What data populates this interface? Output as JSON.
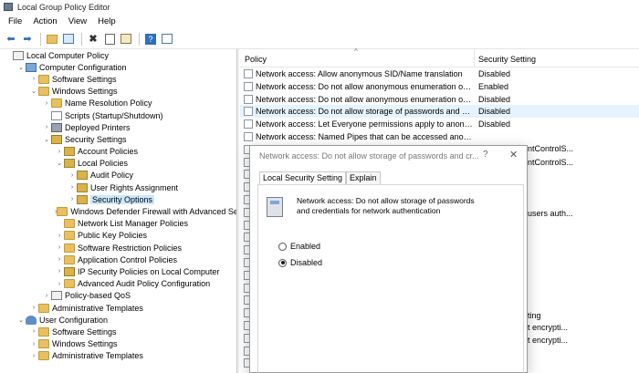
{
  "window": {
    "title": "Local Group Policy Editor"
  },
  "menu": {
    "items": [
      "File",
      "Action",
      "View",
      "Help"
    ]
  },
  "toolbar": {
    "icons": [
      "back-arrow-icon",
      "forward-arrow-icon",
      "up-folder-icon",
      "show-hide-tree-icon",
      "delete-icon",
      "properties-icon",
      "export-icon",
      "help-icon",
      "console-icon"
    ]
  },
  "tree": {
    "nodes": [
      {
        "label": "Local Computer Policy",
        "depth": 0,
        "icon": "policy",
        "twisty": ""
      },
      {
        "label": "Computer Configuration",
        "depth": 1,
        "icon": "computer",
        "twisty": "v"
      },
      {
        "label": "Software Settings",
        "depth": 2,
        "icon": "folder",
        "twisty": ">"
      },
      {
        "label": "Windows Settings",
        "depth": 2,
        "icon": "folder",
        "twisty": "v"
      },
      {
        "label": "Name Resolution Policy",
        "depth": 3,
        "icon": "folder",
        "twisty": ">"
      },
      {
        "label": "Scripts (Startup/Shutdown)",
        "depth": 3,
        "icon": "doc",
        "twisty": ""
      },
      {
        "label": "Deployed Printers",
        "depth": 3,
        "icon": "printer",
        "twisty": ">"
      },
      {
        "label": "Security Settings",
        "depth": 3,
        "icon": "shield",
        "twisty": "v"
      },
      {
        "label": "Account Policies",
        "depth": 4,
        "icon": "lock",
        "twisty": ">"
      },
      {
        "label": "Local Policies",
        "depth": 4,
        "icon": "lock",
        "twisty": "v"
      },
      {
        "label": "Audit Policy",
        "depth": 5,
        "icon": "lock",
        "twisty": ">"
      },
      {
        "label": "User Rights Assignment",
        "depth": 5,
        "icon": "lock",
        "twisty": ">"
      },
      {
        "label": "Security Options",
        "depth": 5,
        "icon": "lock",
        "twisty": ">",
        "selected": true
      },
      {
        "label": "Windows Defender Firewall with Advanced Secu",
        "depth": 4,
        "icon": "folder",
        "twisty": ">"
      },
      {
        "label": "Network List Manager Policies",
        "depth": 4,
        "icon": "folder",
        "twisty": ""
      },
      {
        "label": "Public Key Policies",
        "depth": 4,
        "icon": "folder",
        "twisty": ">"
      },
      {
        "label": "Software Restriction Policies",
        "depth": 4,
        "icon": "folder",
        "twisty": ">"
      },
      {
        "label": "Application Control Policies",
        "depth": 4,
        "icon": "folder",
        "twisty": ">"
      },
      {
        "label": "IP Security Policies on Local Computer",
        "depth": 4,
        "icon": "shield",
        "twisty": ">"
      },
      {
        "label": "Advanced Audit Policy Configuration",
        "depth": 4,
        "icon": "folder",
        "twisty": ">"
      },
      {
        "label": "Policy-based QoS",
        "depth": 3,
        "icon": "policy",
        "twisty": ">"
      },
      {
        "label": "Administrative Templates",
        "depth": 2,
        "icon": "folder",
        "twisty": ">"
      },
      {
        "label": "User Configuration",
        "depth": 1,
        "icon": "user",
        "twisty": "v"
      },
      {
        "label": "Software Settings",
        "depth": 2,
        "icon": "folder",
        "twisty": ">"
      },
      {
        "label": "Windows Settings",
        "depth": 2,
        "icon": "folder",
        "twisty": ">"
      },
      {
        "label": "Administrative Templates",
        "depth": 2,
        "icon": "folder",
        "twisty": ">"
      }
    ]
  },
  "list": {
    "columns": {
      "policy": "Policy",
      "setting": "Security Setting"
    },
    "rows": [
      {
        "policy": "Network access: Allow anonymous SID/Name translation",
        "setting": "Disabled"
      },
      {
        "policy": "Network access: Do not allow anonymous enumeration of S...",
        "setting": "Enabled"
      },
      {
        "policy": "Network access: Do not allow anonymous enumeration of S...",
        "setting": "Disabled"
      },
      {
        "policy": "Network access: Do not allow storage of passwords and cre...",
        "setting": "Disabled",
        "highlight": true
      },
      {
        "policy": "Network access: Let Everyone permissions apply to anonym...",
        "setting": "Disabled"
      },
      {
        "policy": "Network access: Named Pipes that can be accessed anonym...",
        "setting": ""
      }
    ],
    "fragments": [
      "ntControlS...",
      "ntControlS...",
      "users auth...",
      "ting",
      "t encrypti...",
      "t encrypti..."
    ]
  },
  "dialog": {
    "title": "Network access: Do not allow storage of passwords and cr...",
    "help": "?",
    "close": "✕",
    "tabs": [
      "Local Security Setting",
      "Explain"
    ],
    "description": "Network access: Do not allow storage of passwords and credentials for network authentication",
    "options": {
      "enabled": "Enabled",
      "disabled": "Disabled"
    },
    "selected": "disabled"
  }
}
